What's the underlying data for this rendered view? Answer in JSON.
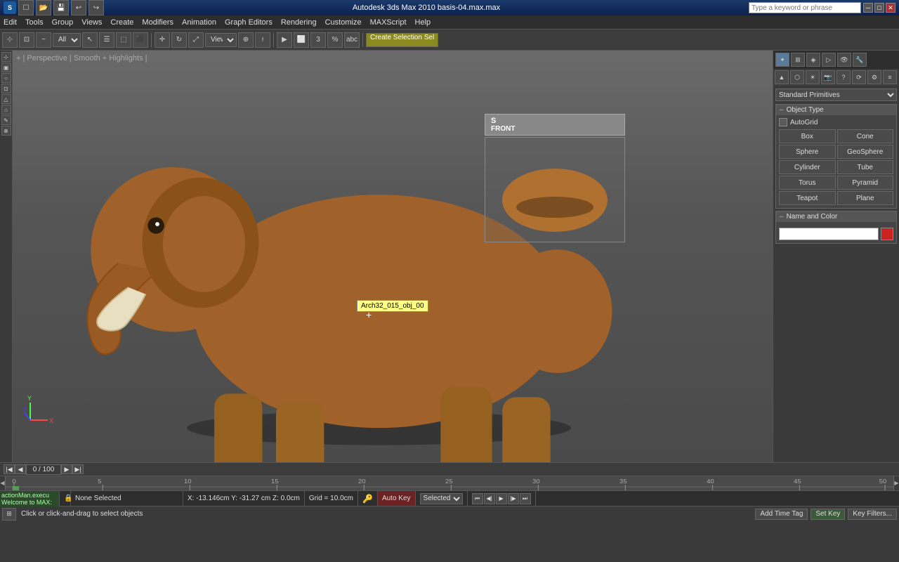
{
  "titlebar": {
    "left_icons": "3ds",
    "title": "Autodesk 3ds Max 2010    basis-04.max.max",
    "search_placeholder": "Type a keyword or phrase"
  },
  "menubar": {
    "items": [
      "Edit",
      "Tools",
      "Group",
      "Views",
      "Create",
      "Modifiers",
      "Animation",
      "Graph Editors",
      "Rendering",
      "Customize",
      "MAXScript",
      "Help"
    ]
  },
  "toolbar": {
    "view_label": "View",
    "create_selection_label": "Create Selection Sel"
  },
  "viewport": {
    "label": "+ | Perspective | Smooth + Highlights |",
    "tooltip": "Arch32_015_obj_00"
  },
  "front_label": "FRONT",
  "right_panel": {
    "primitives_label": "Standard Primitives",
    "object_type_label": "Object Type",
    "autogrid_label": "AutoGrid",
    "buttons": [
      "Box",
      "Cone",
      "Sphere",
      "GeoSphere",
      "Cylinder",
      "Tube",
      "Torus",
      "Pyramid",
      "Teapot",
      "Plane"
    ],
    "name_color_label": "Name and Color"
  },
  "timeline": {
    "frame_range": "0 / 100"
  },
  "statusbar": {
    "none_selected": "None Selected",
    "coords": "X: -13.146cm    Y: -31.27 cm    Z: 0.0cm",
    "grid": "Grid = 10.0cm",
    "auto_key": "Auto Key",
    "selected": "Selected",
    "set_key": "Set Key",
    "key_filters": "Key Filters..."
  },
  "bottom_status": {
    "action": "actionMan.execu",
    "welcome": "Welcome to MAX:",
    "hint": "Click or click-and-drag to select objects",
    "add_time_tag": "Add Time Tag"
  }
}
